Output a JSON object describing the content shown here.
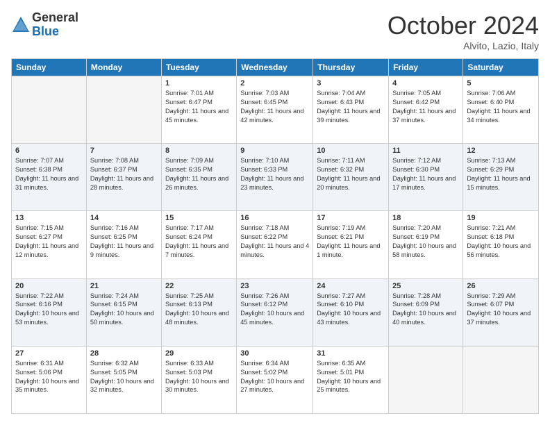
{
  "logo": {
    "general": "General",
    "blue": "Blue"
  },
  "title": "October 2024",
  "location": "Alvito, Lazio, Italy",
  "days_header": [
    "Sunday",
    "Monday",
    "Tuesday",
    "Wednesday",
    "Thursday",
    "Friday",
    "Saturday"
  ],
  "weeks": [
    [
      {
        "day": "",
        "sunrise": "",
        "sunset": "",
        "daylight": ""
      },
      {
        "day": "",
        "sunrise": "",
        "sunset": "",
        "daylight": ""
      },
      {
        "day": "1",
        "sunrise": "Sunrise: 7:01 AM",
        "sunset": "Sunset: 6:47 PM",
        "daylight": "Daylight: 11 hours and 45 minutes."
      },
      {
        "day": "2",
        "sunrise": "Sunrise: 7:03 AM",
        "sunset": "Sunset: 6:45 PM",
        "daylight": "Daylight: 11 hours and 42 minutes."
      },
      {
        "day": "3",
        "sunrise": "Sunrise: 7:04 AM",
        "sunset": "Sunset: 6:43 PM",
        "daylight": "Daylight: 11 hours and 39 minutes."
      },
      {
        "day": "4",
        "sunrise": "Sunrise: 7:05 AM",
        "sunset": "Sunset: 6:42 PM",
        "daylight": "Daylight: 11 hours and 37 minutes."
      },
      {
        "day": "5",
        "sunrise": "Sunrise: 7:06 AM",
        "sunset": "Sunset: 6:40 PM",
        "daylight": "Daylight: 11 hours and 34 minutes."
      }
    ],
    [
      {
        "day": "6",
        "sunrise": "Sunrise: 7:07 AM",
        "sunset": "Sunset: 6:38 PM",
        "daylight": "Daylight: 11 hours and 31 minutes."
      },
      {
        "day": "7",
        "sunrise": "Sunrise: 7:08 AM",
        "sunset": "Sunset: 6:37 PM",
        "daylight": "Daylight: 11 hours and 28 minutes."
      },
      {
        "day": "8",
        "sunrise": "Sunrise: 7:09 AM",
        "sunset": "Sunset: 6:35 PM",
        "daylight": "Daylight: 11 hours and 26 minutes."
      },
      {
        "day": "9",
        "sunrise": "Sunrise: 7:10 AM",
        "sunset": "Sunset: 6:33 PM",
        "daylight": "Daylight: 11 hours and 23 minutes."
      },
      {
        "day": "10",
        "sunrise": "Sunrise: 7:11 AM",
        "sunset": "Sunset: 6:32 PM",
        "daylight": "Daylight: 11 hours and 20 minutes."
      },
      {
        "day": "11",
        "sunrise": "Sunrise: 7:12 AM",
        "sunset": "Sunset: 6:30 PM",
        "daylight": "Daylight: 11 hours and 17 minutes."
      },
      {
        "day": "12",
        "sunrise": "Sunrise: 7:13 AM",
        "sunset": "Sunset: 6:29 PM",
        "daylight": "Daylight: 11 hours and 15 minutes."
      }
    ],
    [
      {
        "day": "13",
        "sunrise": "Sunrise: 7:15 AM",
        "sunset": "Sunset: 6:27 PM",
        "daylight": "Daylight: 11 hours and 12 minutes."
      },
      {
        "day": "14",
        "sunrise": "Sunrise: 7:16 AM",
        "sunset": "Sunset: 6:25 PM",
        "daylight": "Daylight: 11 hours and 9 minutes."
      },
      {
        "day": "15",
        "sunrise": "Sunrise: 7:17 AM",
        "sunset": "Sunset: 6:24 PM",
        "daylight": "Daylight: 11 hours and 7 minutes."
      },
      {
        "day": "16",
        "sunrise": "Sunrise: 7:18 AM",
        "sunset": "Sunset: 6:22 PM",
        "daylight": "Daylight: 11 hours and 4 minutes."
      },
      {
        "day": "17",
        "sunrise": "Sunrise: 7:19 AM",
        "sunset": "Sunset: 6:21 PM",
        "daylight": "Daylight: 11 hours and 1 minute."
      },
      {
        "day": "18",
        "sunrise": "Sunrise: 7:20 AM",
        "sunset": "Sunset: 6:19 PM",
        "daylight": "Daylight: 10 hours and 58 minutes."
      },
      {
        "day": "19",
        "sunrise": "Sunrise: 7:21 AM",
        "sunset": "Sunset: 6:18 PM",
        "daylight": "Daylight: 10 hours and 56 minutes."
      }
    ],
    [
      {
        "day": "20",
        "sunrise": "Sunrise: 7:22 AM",
        "sunset": "Sunset: 6:16 PM",
        "daylight": "Daylight: 10 hours and 53 minutes."
      },
      {
        "day": "21",
        "sunrise": "Sunrise: 7:24 AM",
        "sunset": "Sunset: 6:15 PM",
        "daylight": "Daylight: 10 hours and 50 minutes."
      },
      {
        "day": "22",
        "sunrise": "Sunrise: 7:25 AM",
        "sunset": "Sunset: 6:13 PM",
        "daylight": "Daylight: 10 hours and 48 minutes."
      },
      {
        "day": "23",
        "sunrise": "Sunrise: 7:26 AM",
        "sunset": "Sunset: 6:12 PM",
        "daylight": "Daylight: 10 hours and 45 minutes."
      },
      {
        "day": "24",
        "sunrise": "Sunrise: 7:27 AM",
        "sunset": "Sunset: 6:10 PM",
        "daylight": "Daylight: 10 hours and 43 minutes."
      },
      {
        "day": "25",
        "sunrise": "Sunrise: 7:28 AM",
        "sunset": "Sunset: 6:09 PM",
        "daylight": "Daylight: 10 hours and 40 minutes."
      },
      {
        "day": "26",
        "sunrise": "Sunrise: 7:29 AM",
        "sunset": "Sunset: 6:07 PM",
        "daylight": "Daylight: 10 hours and 37 minutes."
      }
    ],
    [
      {
        "day": "27",
        "sunrise": "Sunrise: 6:31 AM",
        "sunset": "Sunset: 5:06 PM",
        "daylight": "Daylight: 10 hours and 35 minutes."
      },
      {
        "day": "28",
        "sunrise": "Sunrise: 6:32 AM",
        "sunset": "Sunset: 5:05 PM",
        "daylight": "Daylight: 10 hours and 32 minutes."
      },
      {
        "day": "29",
        "sunrise": "Sunrise: 6:33 AM",
        "sunset": "Sunset: 5:03 PM",
        "daylight": "Daylight: 10 hours and 30 minutes."
      },
      {
        "day": "30",
        "sunrise": "Sunrise: 6:34 AM",
        "sunset": "Sunset: 5:02 PM",
        "daylight": "Daylight: 10 hours and 27 minutes."
      },
      {
        "day": "31",
        "sunrise": "Sunrise: 6:35 AM",
        "sunset": "Sunset: 5:01 PM",
        "daylight": "Daylight: 10 hours and 25 minutes."
      },
      {
        "day": "",
        "sunrise": "",
        "sunset": "",
        "daylight": ""
      },
      {
        "day": "",
        "sunrise": "",
        "sunset": "",
        "daylight": ""
      }
    ]
  ]
}
